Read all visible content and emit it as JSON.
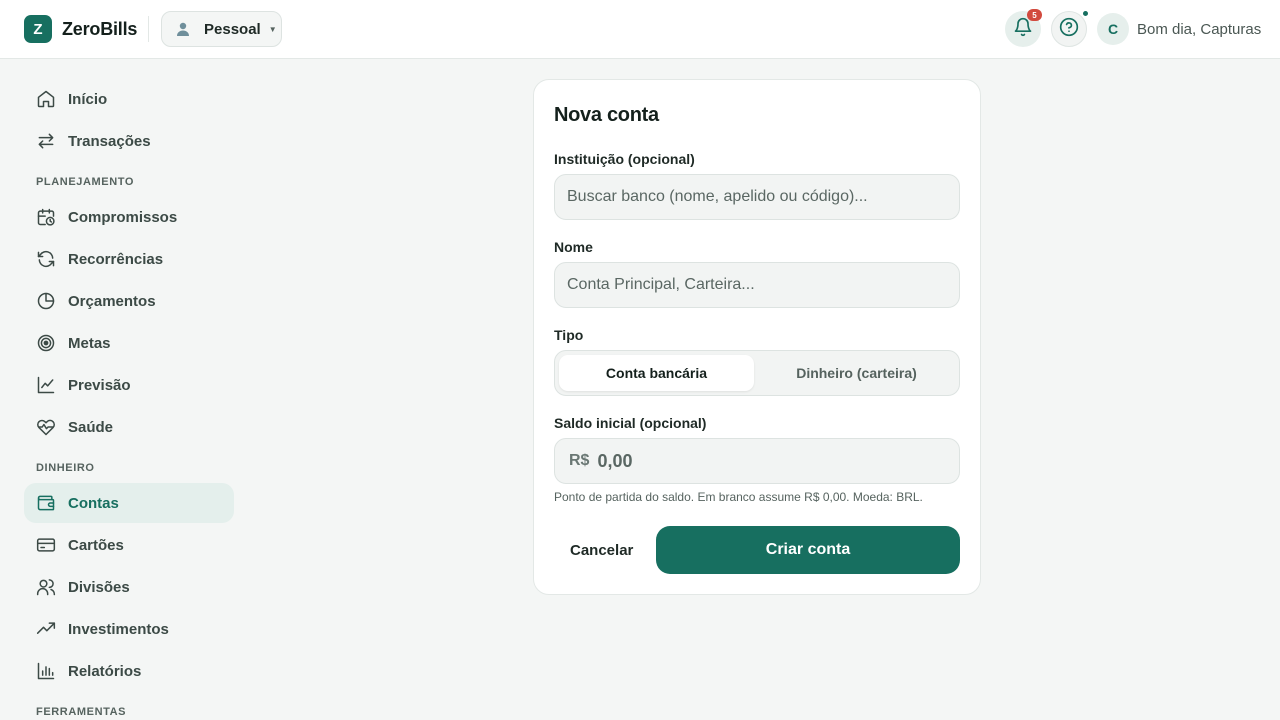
{
  "app": {
    "logo_letter": "Z",
    "name": "ZeroBills"
  },
  "header": {
    "profile_label": "Pessoal",
    "notifications_count": "5",
    "avatar_initial": "C",
    "greeting": "Bom dia, Capturas"
  },
  "sidebar": {
    "items_top": [
      {
        "label": "Início",
        "icon": "home-icon"
      },
      {
        "label": "Transações",
        "icon": "transfer-arrows-icon"
      }
    ],
    "section_planning": "PLANEJAMENTO",
    "items_planning": [
      {
        "label": "Compromissos",
        "icon": "calendar-clock-icon"
      },
      {
        "label": "Recorrências",
        "icon": "refresh-icon"
      },
      {
        "label": "Orçamentos",
        "icon": "pie-chart-icon"
      },
      {
        "label": "Metas",
        "icon": "target-icon"
      },
      {
        "label": "Previsão",
        "icon": "line-chart-icon"
      },
      {
        "label": "Saúde",
        "icon": "heart-pulse-icon"
      }
    ],
    "section_money": "DINHEIRO",
    "items_money": [
      {
        "label": "Contas",
        "icon": "wallet-icon",
        "active": true
      },
      {
        "label": "Cartões",
        "icon": "credit-card-icon"
      },
      {
        "label": "Divisões",
        "icon": "users-icon"
      },
      {
        "label": "Investimentos",
        "icon": "trending-up-icon"
      },
      {
        "label": "Relatórios",
        "icon": "bar-chart-icon"
      }
    ],
    "section_tools": "FERRAMENTAS"
  },
  "form": {
    "title": "Nova conta",
    "institution_label": "Instituição (opcional)",
    "institution_placeholder": "Buscar banco (nome, apelido ou código)...",
    "name_label": "Nome",
    "name_placeholder": "Conta Principal, Carteira...",
    "type_label": "Tipo",
    "type_options": [
      "Conta bancária",
      "Dinheiro (carteira)"
    ],
    "type_selected": "Conta bancária",
    "balance_label": "Saldo inicial (opcional)",
    "currency_symbol": "R$",
    "balance_placeholder": "0,00",
    "hint": "Ponto de partida do saldo. Em branco assume R$ 0,00. Moeda: BRL.",
    "cancel_label": "Cancelar",
    "submit_label": "Criar conta"
  },
  "colors": {
    "accent": "#176f60",
    "badge": "#d24a3e",
    "background": "#f4f6f5"
  }
}
